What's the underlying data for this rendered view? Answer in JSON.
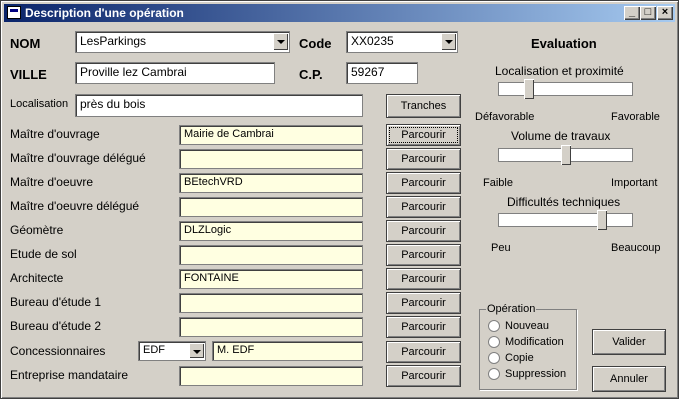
{
  "window": {
    "title": "Description d'une opération"
  },
  "labels": {
    "nom": "NOM",
    "code": "Code",
    "ville": "VILLE",
    "cp": "C.P.",
    "localisation": "Localisation",
    "evaluation": "Evaluation"
  },
  "fields": {
    "nom": "LesParkings",
    "code": "XX0235",
    "ville": "Proville lez Cambrai",
    "cp": "59267",
    "localisation": "près du bois"
  },
  "tranches_label": "Tranches",
  "parcourir_label": "Parcourir",
  "rows": [
    {
      "label": "Maître d'ouvrage",
      "value": "Mairie de Cambrai"
    },
    {
      "label": "Maître d'ouvrage délégué",
      "value": ""
    },
    {
      "label": "Maître d'oeuvre",
      "value": "BEtechVRD"
    },
    {
      "label": "Maître d'oeuvre délégué",
      "value": ""
    },
    {
      "label": "Géomètre",
      "value": "DLZLogic"
    },
    {
      "label": "Etude de sol",
      "value": ""
    },
    {
      "label": "Architecte",
      "value": "FONTAINE"
    },
    {
      "label": "Bureau d'étude 1",
      "value": ""
    },
    {
      "label": "Bureau d'étude 2",
      "value": ""
    },
    {
      "label": "Concessionnaires",
      "value": "M. EDF",
      "combo": "EDF"
    },
    {
      "label": "Entreprise mandataire",
      "value": ""
    }
  ],
  "sliders": [
    {
      "title": "Localisation et proximité",
      "left": "Défavorable",
      "right": "Favorable",
      "level": 0.2
    },
    {
      "title": "Volume de travaux",
      "left": "Faible",
      "right": "Important",
      "level": 0.5
    },
    {
      "title": "Difficultés techniques",
      "left": "Peu",
      "right": "Beaucoup",
      "level": 0.8
    }
  ],
  "operation": {
    "title": "Opération",
    "options": [
      "Nouveau",
      "Modification",
      "Copie",
      "Suppression"
    ]
  },
  "buttons": {
    "valider": "Valider",
    "annuler": "Annuler"
  }
}
